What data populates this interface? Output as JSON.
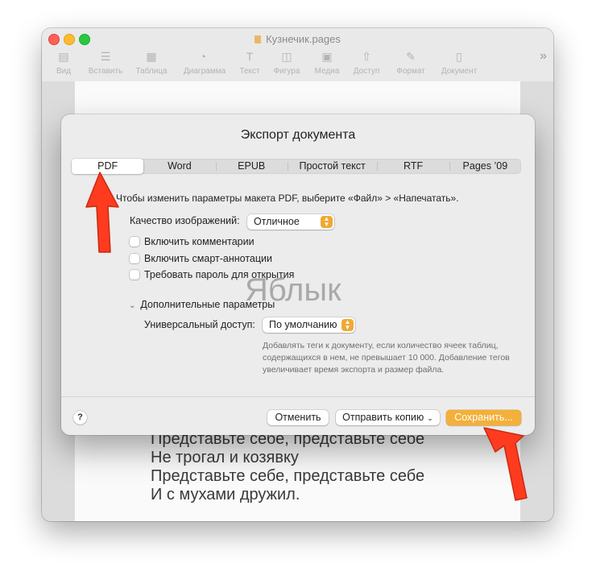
{
  "window": {
    "title": "Кузнечик.pages",
    "toolbar": [
      {
        "label": "Вид",
        "icon": "sidebar-icon",
        "glyph": "▤"
      },
      {
        "label": "Вставить",
        "icon": "insert-icon",
        "glyph": "☰"
      },
      {
        "label": "Таблица",
        "icon": "table-icon",
        "glyph": "▦"
      },
      {
        "label": "Диаграмма",
        "icon": "chart-icon",
        "glyph": "◔"
      },
      {
        "label": "Текст",
        "icon": "text-icon",
        "glyph": "T"
      },
      {
        "label": "Фигура",
        "icon": "shape-icon",
        "glyph": "◫"
      },
      {
        "label": "Медиа",
        "icon": "media-icon",
        "glyph": "▣"
      },
      {
        "label": "Доступ",
        "icon": "share-icon",
        "glyph": "⇧"
      },
      {
        "label": "Формат",
        "icon": "format-icon",
        "glyph": "✎"
      },
      {
        "label": "Документ",
        "icon": "document-icon",
        "glyph": "▯"
      }
    ],
    "overflow_glyph": "»"
  },
  "document": {
    "lines": [
      "Представьте себе, представьте себе",
      "Не трогал и козявку",
      "Представьте себе, представьте себе",
      "И с мухами дружил."
    ]
  },
  "dialog": {
    "title": "Экспорт документа",
    "tabs": [
      "PDF",
      "Word",
      "EPUB",
      "Простой текст",
      "RTF",
      "Pages ’09"
    ],
    "active_tab": "PDF",
    "hint": "Чтобы изменить параметры макета PDF, выберите «Файл» > «Напечатать».",
    "quality": {
      "label": "Качество изображений:",
      "value": "Отличное"
    },
    "checkboxes": [
      {
        "label": "Включить комментарии",
        "checked": false
      },
      {
        "label": "Включить смарт-аннотации",
        "checked": false
      },
      {
        "label": "Требовать пароль для открытия",
        "checked": false
      }
    ],
    "advanced": {
      "label": "Дополнительные параметры",
      "accessibility_label": "Универсальный доступ:",
      "accessibility_value": "По умолчанию",
      "note": "Добавлять теги к документу, если количество ячеек таблиц, содержащихся в нем, не превышает 10 000. Добавление тегов увеличивает время экспорта и размер файла."
    },
    "help": "?",
    "buttons": {
      "cancel": "Отменить",
      "send_copy": "Отправить копию",
      "save": "Сохранить..."
    }
  },
  "watermark": "Яблык",
  "colors": {
    "accent": "#f3b03a",
    "arrow": "#ff3b1f"
  }
}
